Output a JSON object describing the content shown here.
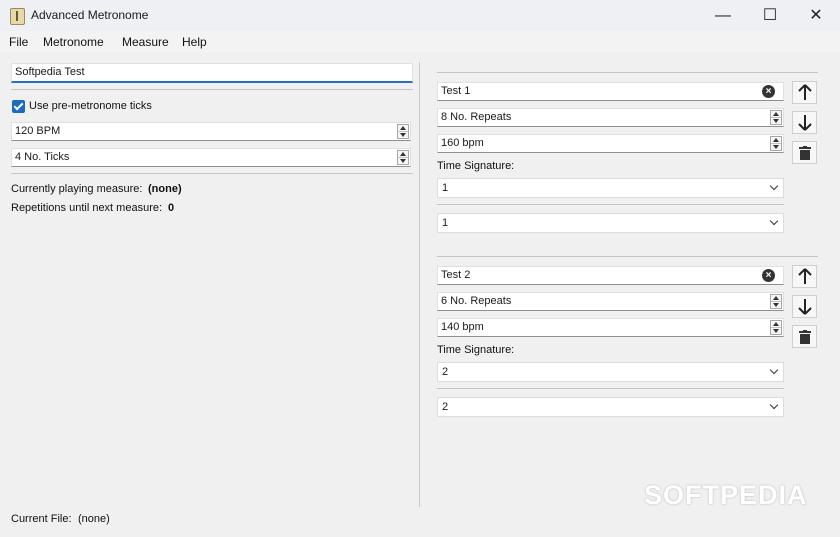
{
  "window": {
    "title": "Advanced Metronome",
    "minimize_glyph": "—",
    "maximize_glyph": "☐",
    "close_glyph": "✕"
  },
  "menu": [
    "File",
    "Metronome",
    "Measure",
    "Help"
  ],
  "left": {
    "name_value": "Softpedia Test",
    "pre_ticks_label": "Use pre-metronome ticks",
    "pre_ticks_checked": true,
    "bpm_value": "120 BPM",
    "ticks_value": "4 No. Ticks",
    "current_measure_label": "Currently playing measure:",
    "current_measure_value": "(none)",
    "repetitions_label": "Repetitions until next measure:",
    "repetitions_value": "0"
  },
  "measures": [
    {
      "name": "Test 1",
      "repeats": "8 No. Repeats",
      "bpm": "160 bpm",
      "time_sig_label": "Time Signature:",
      "numerator": "1",
      "denominator": "1"
    },
    {
      "name": "Test 2",
      "repeats": "6 No. Repeats",
      "bpm": "140 bpm",
      "time_sig_label": "Time Signature:",
      "numerator": "2",
      "denominator": "2"
    }
  ],
  "footer": {
    "current_file_label": "Current File:",
    "current_file_value": "(none)"
  },
  "watermark": "SOFTPEDIA",
  "colors": {
    "accent": "#1d6bbf",
    "window_bg": "#f0f0f0"
  },
  "icons": [
    "app-icon",
    "clear-icon",
    "arrow-up-icon",
    "arrow-down-icon",
    "trash-icon",
    "chevron-down-icon"
  ]
}
